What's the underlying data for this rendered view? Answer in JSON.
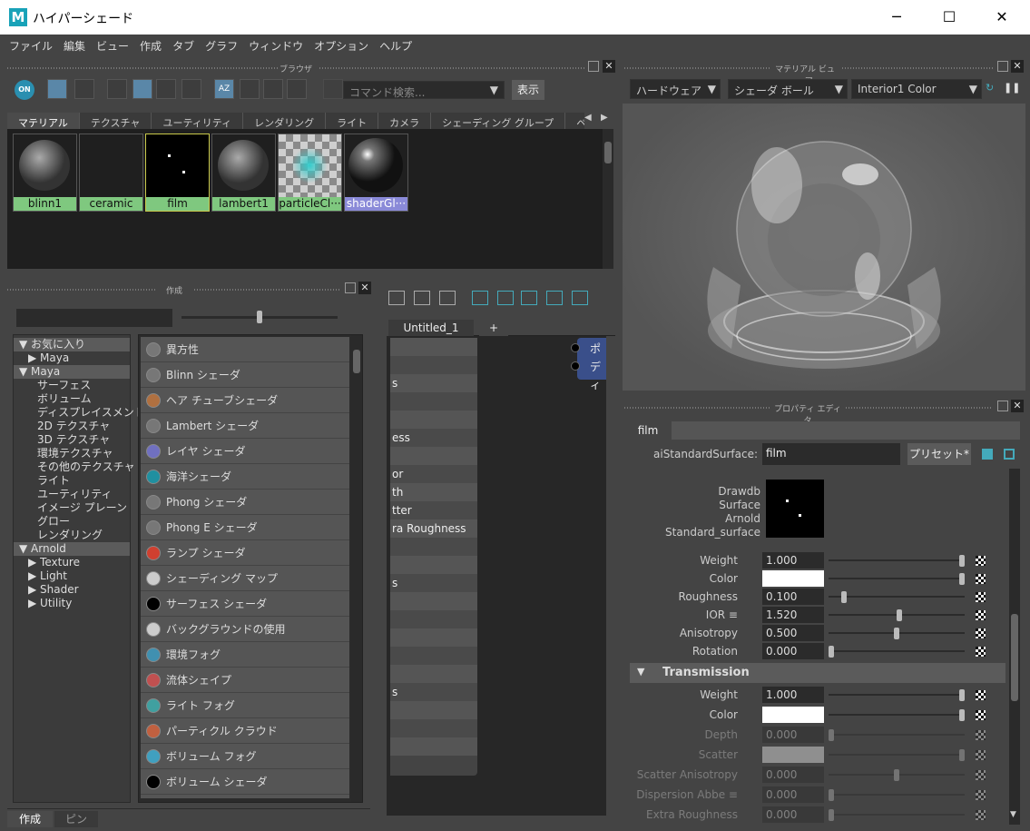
{
  "window": {
    "title": "ハイパーシェード",
    "app_icon": "M",
    "min": "─",
    "max": "☐",
    "close": "✕"
  },
  "menu": [
    "ファイル",
    "編集",
    "ビュー",
    "作成",
    "タブ",
    "グラフ",
    "ウィンドウ",
    "オプション",
    "ヘルプ"
  ],
  "browser": {
    "title": "ブラウザ",
    "on_label": "ON",
    "search_placeholder": "コマンド検索...",
    "show_button": "表示",
    "tabs": [
      "マテリアル",
      "テクスチャ",
      "ユーティリティ",
      "レンダリング",
      "ライト",
      "カメラ",
      "シェーディング グループ",
      "ベイク セット"
    ],
    "materials": [
      {
        "name": "blinn1",
        "type": "sphere"
      },
      {
        "name": "ceramic",
        "type": "blank"
      },
      {
        "name": "film",
        "type": "stars"
      },
      {
        "name": "lambert1",
        "type": "sphere"
      },
      {
        "name": "particleCl···",
        "type": "checker"
      },
      {
        "name": "shaderGl···",
        "type": "glossy"
      }
    ]
  },
  "create": {
    "title": "作成",
    "tree": [
      {
        "label": "▼ お気に入り",
        "hdr": true,
        "indent": 0
      },
      {
        "label": "▶ Maya",
        "hdr": false,
        "indent": 1
      },
      {
        "label": "▼ Maya",
        "hdr": true,
        "indent": 0
      },
      {
        "label": "サーフェス",
        "hdr": false,
        "indent": 2
      },
      {
        "label": "ボリューム",
        "hdr": false,
        "indent": 2
      },
      {
        "label": "ディスプレイスメント",
        "hdr": false,
        "indent": 2
      },
      {
        "label": "2D テクスチャ",
        "hdr": false,
        "indent": 2
      },
      {
        "label": "3D テクスチャ",
        "hdr": false,
        "indent": 2
      },
      {
        "label": "環境テクスチャ",
        "hdr": false,
        "indent": 2
      },
      {
        "label": "その他のテクスチャ",
        "hdr": false,
        "indent": 2
      },
      {
        "label": "ライト",
        "hdr": false,
        "indent": 2
      },
      {
        "label": "ユーティリティ",
        "hdr": false,
        "indent": 2
      },
      {
        "label": "イメージ プレーン",
        "hdr": false,
        "indent": 2
      },
      {
        "label": "グロー",
        "hdr": false,
        "indent": 2
      },
      {
        "label": "レンダリング",
        "hdr": false,
        "indent": 2
      },
      {
        "label": "▼ Arnold",
        "hdr": true,
        "indent": 0
      },
      {
        "label": "▶ Texture",
        "hdr": false,
        "indent": 1
      },
      {
        "label": "▶ Light",
        "hdr": false,
        "indent": 1
      },
      {
        "label": "▶ Shader",
        "hdr": false,
        "indent": 1
      },
      {
        "label": "▶ Utility",
        "hdr": false,
        "indent": 1
      }
    ],
    "list": [
      {
        "label": "異方性",
        "color": "#777"
      },
      {
        "label": "Blinn シェーダ",
        "color": "#777"
      },
      {
        "label": "ヘア チューブシェーダ",
        "color": "#b07040"
      },
      {
        "label": "Lambert シェーダ",
        "color": "#777"
      },
      {
        "label": "レイヤ シェーダ",
        "color": "#7070c0"
      },
      {
        "label": "海洋シェーダ",
        "color": "#2090a0"
      },
      {
        "label": "Phong シェーダ",
        "color": "#777"
      },
      {
        "label": "Phong E シェーダ",
        "color": "#777"
      },
      {
        "label": "ランプ シェーダ",
        "color": "#d04030"
      },
      {
        "label": "シェーディング マップ",
        "color": "#ccc"
      },
      {
        "label": "サーフェス シェーダ",
        "color": "#000"
      },
      {
        "label": "バックグラウンドの使用",
        "color": "#ccc"
      },
      {
        "label": "環境フォグ",
        "color": "#4090b0"
      },
      {
        "label": "流体シェイプ",
        "color": "#c05050"
      },
      {
        "label": "ライト フォグ",
        "color": "#40a0a0"
      },
      {
        "label": "パーティクル クラウド",
        "color": "#c06040"
      },
      {
        "label": "ボリューム フォグ",
        "color": "#40a0c0"
      },
      {
        "label": "ボリューム シェーダ",
        "color": "#000"
      }
    ],
    "bottom_tabs": [
      "作成",
      "ピン"
    ]
  },
  "graph": {
    "tab": "Untitled_1",
    "add_tab": "+",
    "node_rows": [
      "",
      "",
      "s",
      "",
      "",
      "ess",
      "",
      "or",
      "th",
      "tter",
      "ra Roughness",
      "",
      "",
      "s",
      "",
      "",
      "",
      "",
      "",
      "s",
      "",
      "",
      ""
    ],
    "node2_lines": [
      "ポ",
      "ディ"
    ]
  },
  "viewer": {
    "title": "マテリアル ビューア",
    "renderer": "ハードウェア",
    "geometry": "シェーダ ボール",
    "environment": "Interior1 Color"
  },
  "props": {
    "title": "プロパティ エディタ",
    "tab": "film",
    "type_label": "aiStandardSurface:",
    "node_name": "film",
    "preset": "プリセット*",
    "swatch_caption": [
      "Drawdb",
      "Surface",
      "Arnold",
      "Standard_surface"
    ],
    "specular_rows": [
      {
        "label": "Weight",
        "value": "1.000",
        "pos": 1.0,
        "kind": "num",
        "dim": false
      },
      {
        "label": "Color",
        "value": "",
        "pos": 1.0,
        "kind": "color",
        "dim": false
      },
      {
        "label": "Roughness",
        "value": "0.100",
        "pos": 0.1,
        "kind": "num",
        "dim": false
      },
      {
        "label": "IOR ≡",
        "value": "1.520",
        "pos": 0.52,
        "kind": "num",
        "dim": false
      },
      {
        "label": "Anisotropy",
        "value": "0.500",
        "pos": 0.5,
        "kind": "num",
        "dim": false
      },
      {
        "label": "Rotation",
        "value": "0.000",
        "pos": 0.0,
        "kind": "num",
        "dim": false
      }
    ],
    "transmission_header": "Transmission",
    "transmission_rows": [
      {
        "label": "Weight",
        "value": "1.000",
        "pos": 1.0,
        "kind": "num",
        "dim": false
      },
      {
        "label": "Color",
        "value": "",
        "pos": 1.0,
        "kind": "color",
        "dim": false
      },
      {
        "label": "Depth",
        "value": "0.000",
        "pos": 0.0,
        "kind": "num",
        "dim": true
      },
      {
        "label": "Scatter",
        "value": "",
        "pos": 1.0,
        "kind": "color",
        "dim": true
      },
      {
        "label": "Scatter Anisotropy",
        "value": "0.000",
        "pos": 0.5,
        "kind": "num",
        "dim": true
      },
      {
        "label": "Dispersion Abbe ≡",
        "value": "0.000",
        "pos": 0.0,
        "kind": "num",
        "dim": true
      },
      {
        "label": "Extra Roughness",
        "value": "0.000",
        "pos": 0.0,
        "kind": "num",
        "dim": true
      }
    ]
  }
}
